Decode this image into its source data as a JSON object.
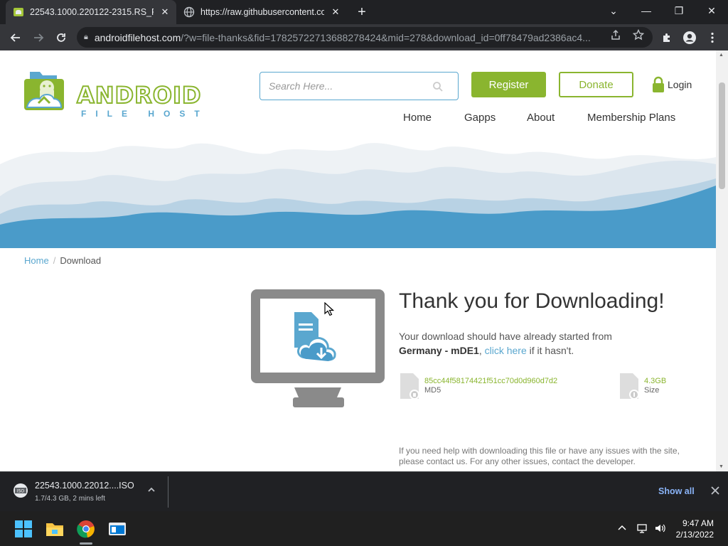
{
  "browser": {
    "tabs": [
      {
        "title": "22543.1000.220122-2315.RS_PRE",
        "close": "✕"
      },
      {
        "title": "https://raw.githubusercontent.co",
        "close": "✕"
      }
    ],
    "new_tab": "+",
    "window_controls": {
      "dropdown": "⌄",
      "minimize": "—",
      "restore": "❐",
      "close": "✕"
    },
    "url_host": "androidfilehost.com",
    "url_rest": "/?w=file-thanks&fid=17825722713688278424&mid=278&download_id=0ff78479ad2386ac4..."
  },
  "site": {
    "logo_word": "ANDROID",
    "logo_sub": "FILE HOST",
    "search_placeholder": "Search Here...",
    "register": "Register",
    "donate": "Donate",
    "login": "Login",
    "nav": [
      "Home",
      "Gapps",
      "About",
      "Membership Plans"
    ]
  },
  "breadcrumb": {
    "home": "Home",
    "separator": "/",
    "current": "Download"
  },
  "download_page": {
    "heading": "Thank you for Downloading!",
    "message_pre": "Your download should have already started from",
    "mirror": "Germany - mDE1",
    "comma": ",",
    "link": "click here",
    "message_post": "if it hasn't.",
    "md5_value": "85cc44f58174421f51cc70d0d960d7d2",
    "md5_label": "MD5",
    "size_value": "4.3GB",
    "size_label": "Size",
    "help_text": "If you need help with downloading this file or have any issues with the site, please contact us. For any other issues, contact the developer."
  },
  "download_bar": {
    "filename": "22543.1000.22012....ISO",
    "status": "1.7/4.3 GB, 2 mins left",
    "show_all": "Show all",
    "close": "✕"
  },
  "taskbar": {
    "time": "9:47 AM",
    "date": "2/13/2022"
  },
  "colors": {
    "brand_green": "#8ab52f",
    "brand_blue": "#5aa7cf",
    "chrome_dark": "#202124"
  }
}
